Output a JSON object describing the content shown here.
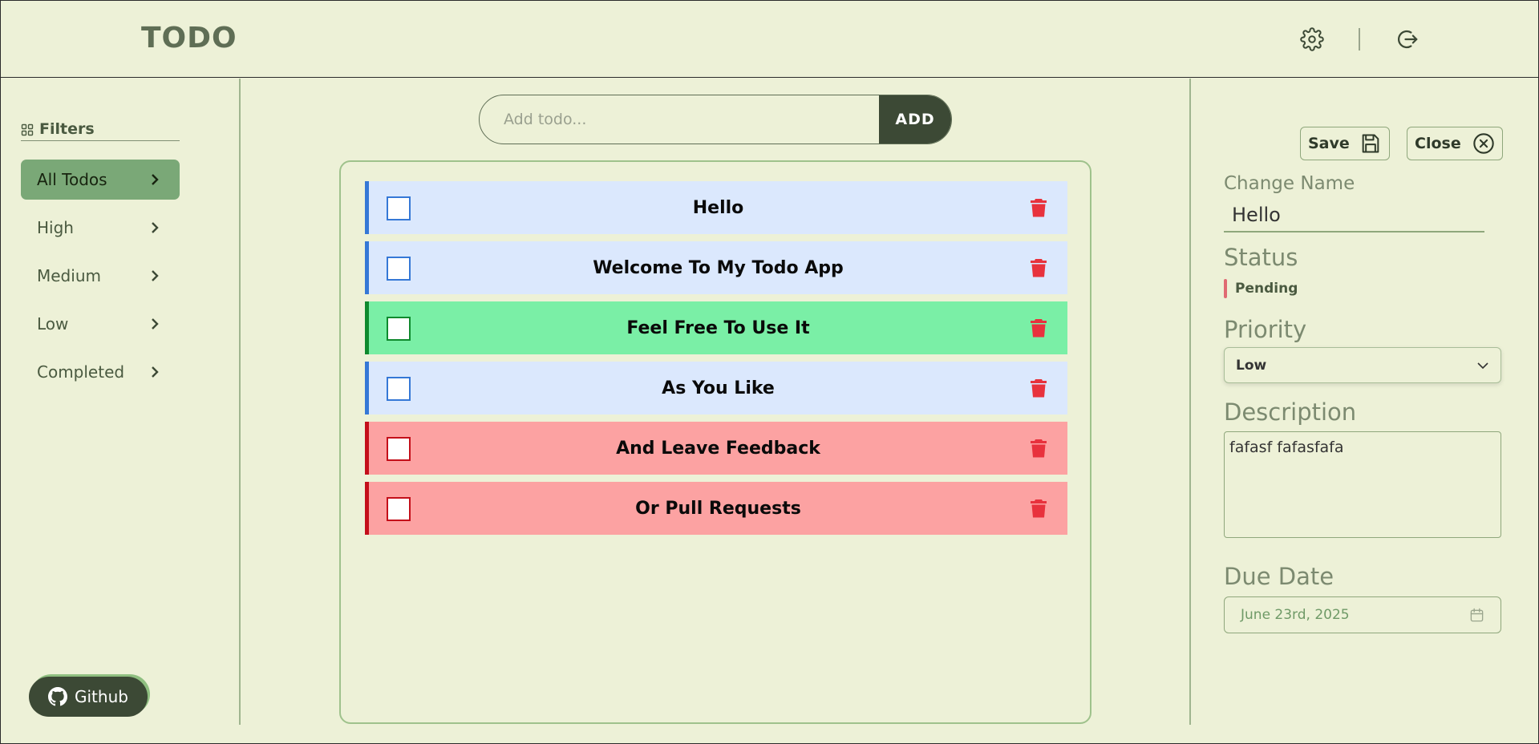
{
  "header": {
    "logo": "TODO",
    "icons": [
      "gear-icon",
      "logout-icon"
    ]
  },
  "sidebar": {
    "filters_title": "Filters",
    "items": [
      {
        "label": "All Todos",
        "active": true
      },
      {
        "label": "High",
        "active": false
      },
      {
        "label": "Medium",
        "active": false
      },
      {
        "label": "Low",
        "active": false
      },
      {
        "label": "Completed",
        "active": false
      }
    ],
    "github_label": "Github"
  },
  "add_todo": {
    "placeholder": "Add todo...",
    "button_label": "ADD"
  },
  "todos": [
    {
      "title": "Hello",
      "priority": "low",
      "bg": "#dbe8fd",
      "accent": "#3578d6"
    },
    {
      "title": "Welcome To My Todo App",
      "priority": "low",
      "bg": "#dbe8fd",
      "accent": "#3578d6"
    },
    {
      "title": "Feel Free To Use It",
      "priority": "medium",
      "bg": "#7aefa6",
      "accent": "#0f8a2e"
    },
    {
      "title": "As You Like",
      "priority": "low",
      "bg": "#dbe8fd",
      "accent": "#3578d6"
    },
    {
      "title": "And Leave Feedback",
      "priority": "high",
      "bg": "#fca2a2",
      "accent": "#c40f1a"
    },
    {
      "title": "Or Pull Requests",
      "priority": "high",
      "bg": "#fca2a2",
      "accent": "#c40f1a"
    }
  ],
  "details": {
    "save_label": "Save",
    "close_label": "Close",
    "change_name_label": "Change Name",
    "name_value": "Hello",
    "status_label": "Status",
    "status_value": "Pending",
    "priority_label": "Priority",
    "priority_value": "Low",
    "description_label": "Description",
    "description_value": "fafasf fafasfafa",
    "due_date_label": "Due Date",
    "due_date_value": "June 23rd, 2025"
  },
  "colors": {
    "background": "#edf1d7",
    "accent_dark": "#3c4935",
    "accent_green": "#7aa877",
    "trash": "#e8323d"
  }
}
